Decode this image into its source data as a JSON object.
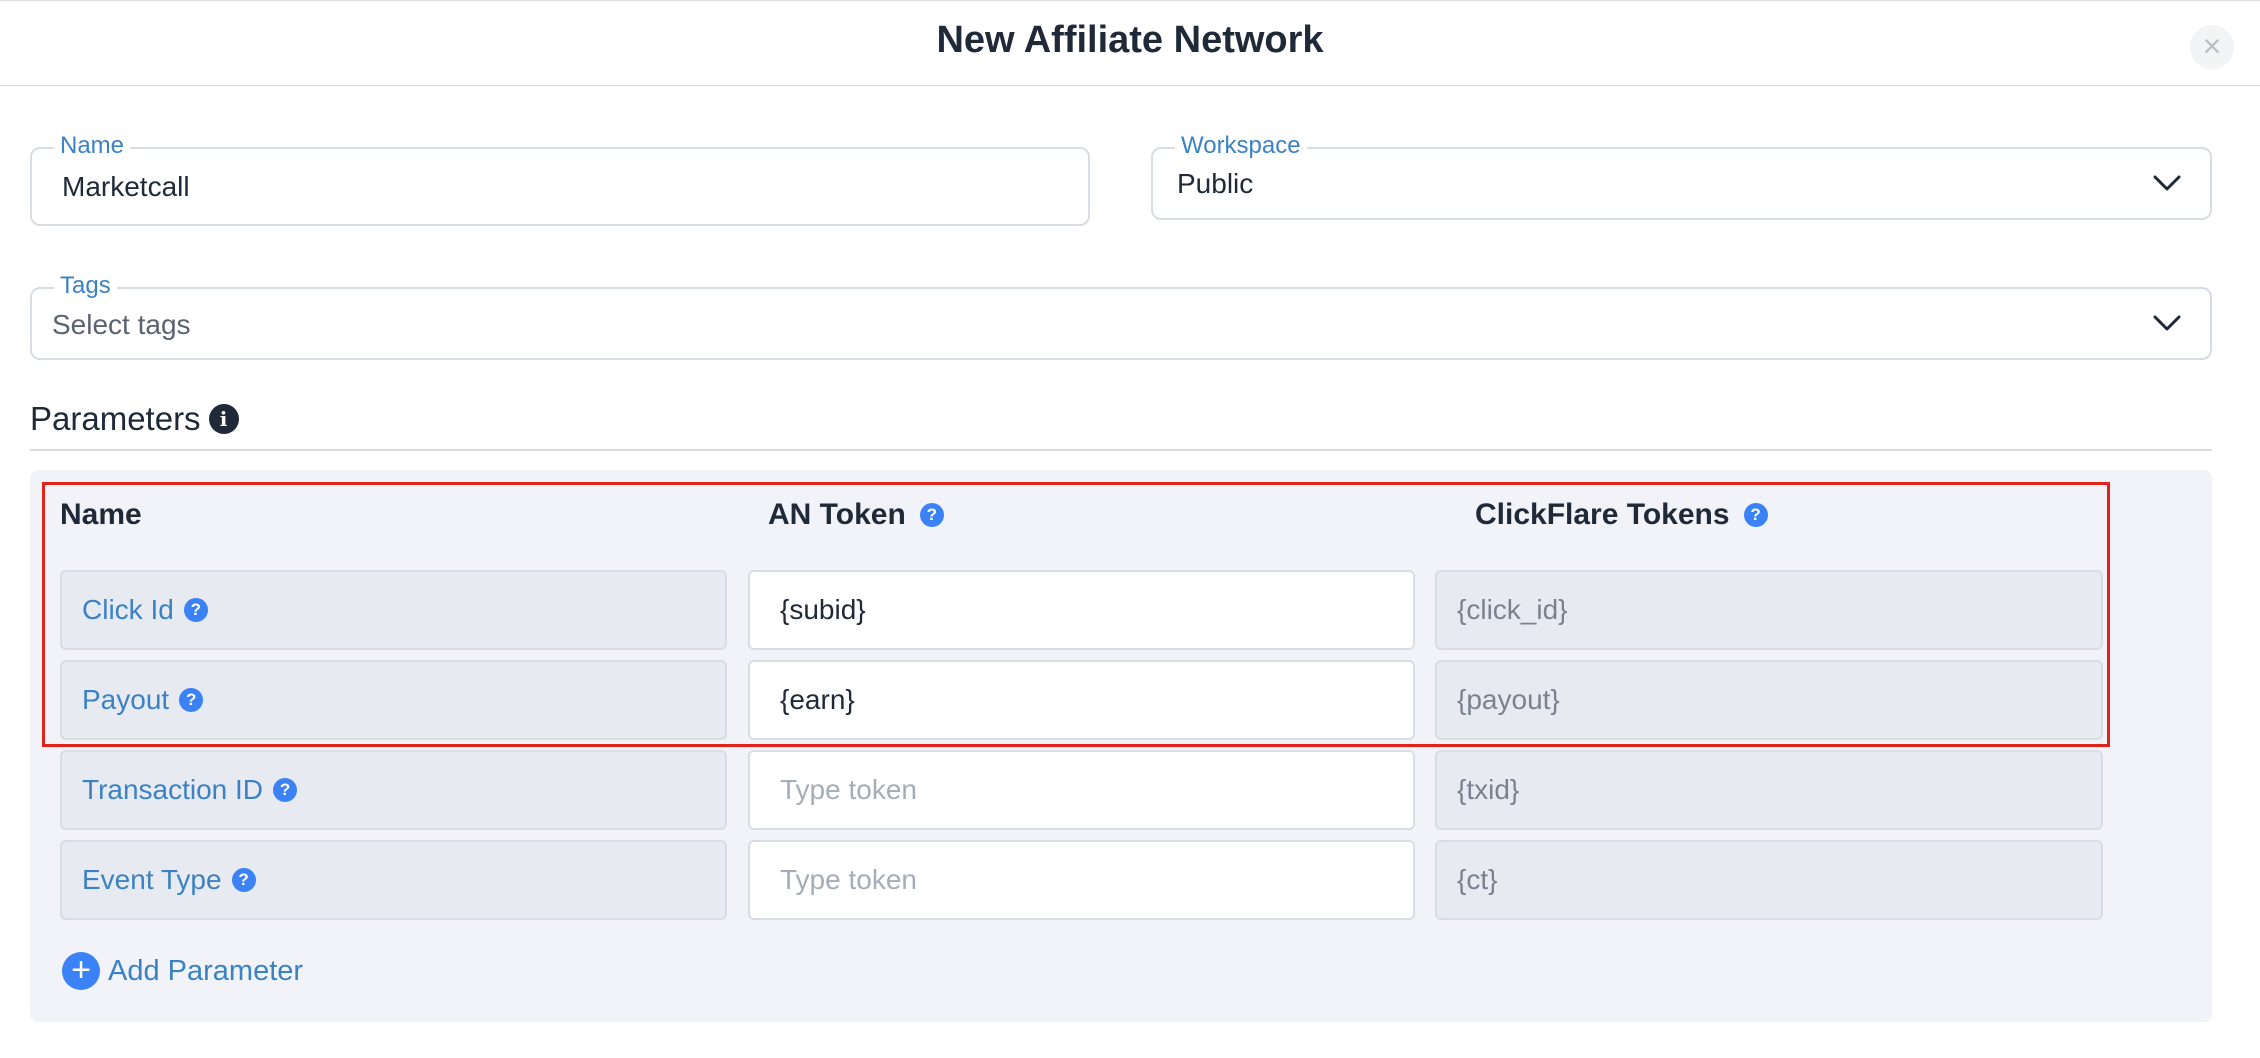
{
  "modal": {
    "title": "New Affiliate Network",
    "close_icon": "×"
  },
  "form": {
    "name": {
      "label": "Name",
      "value": "Marketcall"
    },
    "workspace": {
      "label": "Workspace",
      "value": "Public",
      "icon": "chevron-down-icon"
    },
    "tags": {
      "label": "Tags",
      "placeholder": "Select tags",
      "icon": "chevron-down-icon"
    }
  },
  "parameters": {
    "title": "Parameters",
    "info_icon": "i",
    "columns": {
      "name": "Name",
      "an_token": "AN Token",
      "clickflare_tokens": "ClickFlare Tokens"
    },
    "help_icon": "?",
    "rows": [
      {
        "name": "Click Id",
        "an_token": "{subid}",
        "an_token_placeholder": "",
        "clickflare_token": "{click_id}"
      },
      {
        "name": "Payout",
        "an_token": "{earn}",
        "an_token_placeholder": "",
        "clickflare_token": "{payout}"
      },
      {
        "name": "Transaction ID",
        "an_token": "",
        "an_token_placeholder": "Type token",
        "clickflare_token": "{txid}"
      },
      {
        "name": "Event Type",
        "an_token": "",
        "an_token_placeholder": "Type token",
        "clickflare_token": "{ct}"
      }
    ],
    "add_label": "Add Parameter",
    "add_icon": "+"
  },
  "colors": {
    "accent": "#3b82f6",
    "label_blue": "#3b82c4",
    "highlight": "#e0241c",
    "panel_bg": "#f1f3f9"
  }
}
